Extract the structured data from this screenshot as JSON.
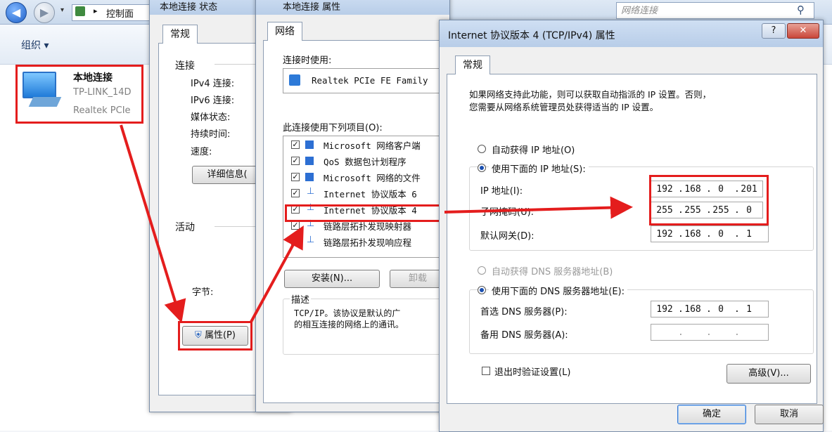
{
  "explorer": {
    "breadcrumb": "控制面",
    "search_placeholder": "网络连接",
    "organize": "组织 ▾",
    "connection": {
      "name": "本地连接",
      "network": "TP-LINK_14D",
      "adapter": "Realtek PCIe"
    }
  },
  "status_dialog": {
    "title": "本地连接 状态",
    "tab": "常规",
    "section_connection": "连接",
    "rows": [
      "IPv4 连接:",
      "IPv6 连接:",
      "媒体状态:",
      "持续时间:",
      "速度:"
    ],
    "details_button": "详细信息(",
    "section_activity": "活动",
    "bytes_label": "字节:",
    "properties_button": "属性(P)"
  },
  "props_dialog": {
    "title": "本地连接 属性",
    "tab": "网络",
    "connect_using_label": "连接时使用:",
    "adapter": "Realtek PCIe FE Family",
    "items_label": "此连接使用下列项目(O):",
    "items": [
      "Microsoft 网络客户端",
      "QoS 数据包计划程序",
      "Microsoft 网络的文件",
      "Internet 协议版本 6",
      "Internet 协议版本 4",
      "链路层拓扑发现映射器",
      "链路层拓扑发现响应程"
    ],
    "install_button": "安装(N)...",
    "uninstall_button": "卸载",
    "description_label": "描述",
    "description_line1": "TCP/IP。该协议是默认的广",
    "description_line2": "的相互连接的网络上的通讯。"
  },
  "ipv4_dialog": {
    "title": "Internet 协议版本 4 (TCP/IPv4) 属性",
    "help_glyph": "?",
    "close_glyph": "✕",
    "tab": "常规",
    "intro_line1": "如果网络支持此功能，则可以获取自动指派的 IP 设置。否则，",
    "intro_line2": "您需要从网络系统管理员处获得适当的 IP 设置。",
    "auto_ip": "自动获得 IP 地址(O)",
    "manual_ip": "使用下面的 IP 地址(S):",
    "ip_label": "IP 地址(I):",
    "ip_value": [
      "192",
      "168",
      "0",
      "201"
    ],
    "mask_label": "子网掩码(U):",
    "mask_value": [
      "255",
      "255",
      "255",
      "0"
    ],
    "gateway_label": "默认网关(D):",
    "gateway_value": [
      "192",
      "168",
      "0",
      "1"
    ],
    "auto_dns": "自动获得 DNS 服务器地址(B)",
    "manual_dns": "使用下面的 DNS 服务器地址(E):",
    "dns1_label": "首选 DNS 服务器(P):",
    "dns1_value": [
      "192",
      "168",
      "0",
      "1"
    ],
    "dns2_label": "备用 DNS 服务器(A):",
    "validate_label": "退出时验证设置(L)",
    "advanced_button": "高级(V)...",
    "ok_button": "确定",
    "cancel_button": "取消"
  },
  "colors": {
    "annotation_red": "#e41d1d",
    "titlebar": "#b8cde8",
    "close_red": "#c9473a"
  }
}
